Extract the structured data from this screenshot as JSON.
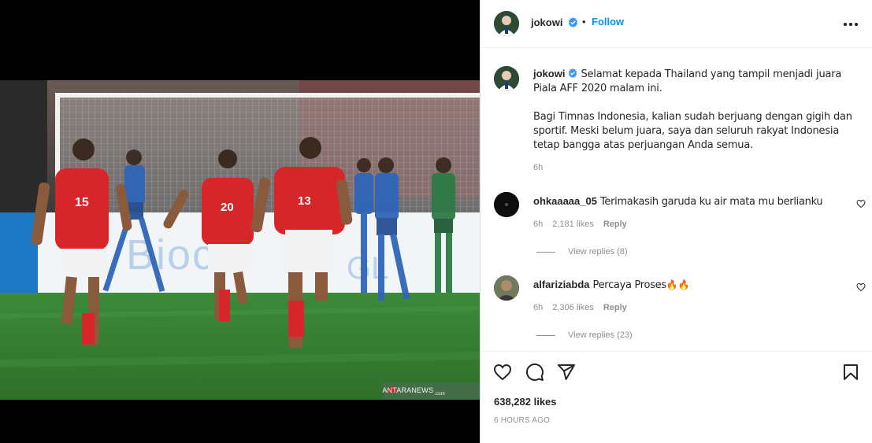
{
  "post": {
    "author": "jokowi",
    "follow_label": "Follow",
    "separator": "•",
    "watermark": {
      "brand": "ANTARANEWS",
      "suffix": ".com"
    }
  },
  "caption": {
    "username": "jokowi",
    "paragraph1": "Selamat kepada Thailand yang tampil menjadi juara Piala AFF 2020 malam ini.",
    "paragraph2": "Bagi Timnas Indonesia, kalian sudah berjuang dengan gigih dan sportif. Meski belum juara, saya dan seluruh rakyat Indonesia tetap bangga atas perjuangan Anda semua.",
    "time": "6h"
  },
  "comments": [
    {
      "username": "ohkaaaaa_05",
      "text": "Terimakasih garuda ku air mata mu berlianku",
      "emoji": "",
      "time": "6h",
      "likes": "2,181 likes",
      "reply_label": "Reply",
      "view_replies": "View replies (8)"
    },
    {
      "username": "alfariziabda",
      "text": "Percaya Proses",
      "emoji": "🔥🔥",
      "time": "6h",
      "likes": "2,306 likes",
      "reply_label": "Reply",
      "view_replies": "View replies (23)"
    }
  ],
  "footer": {
    "likes": "638,282 likes",
    "posted": "6 HOURS AGO"
  },
  "icons": [
    "verified-badge-icon",
    "more-options-icon",
    "heart-icon",
    "comment-icon",
    "share-icon",
    "bookmark-icon"
  ],
  "colors": {
    "accent": "#0095f6",
    "muted": "#8e8e8e",
    "text": "#262626",
    "border": "#dbdbdb",
    "jersey_red": "#d7262a",
    "jersey_blue": "#2f66b8"
  }
}
